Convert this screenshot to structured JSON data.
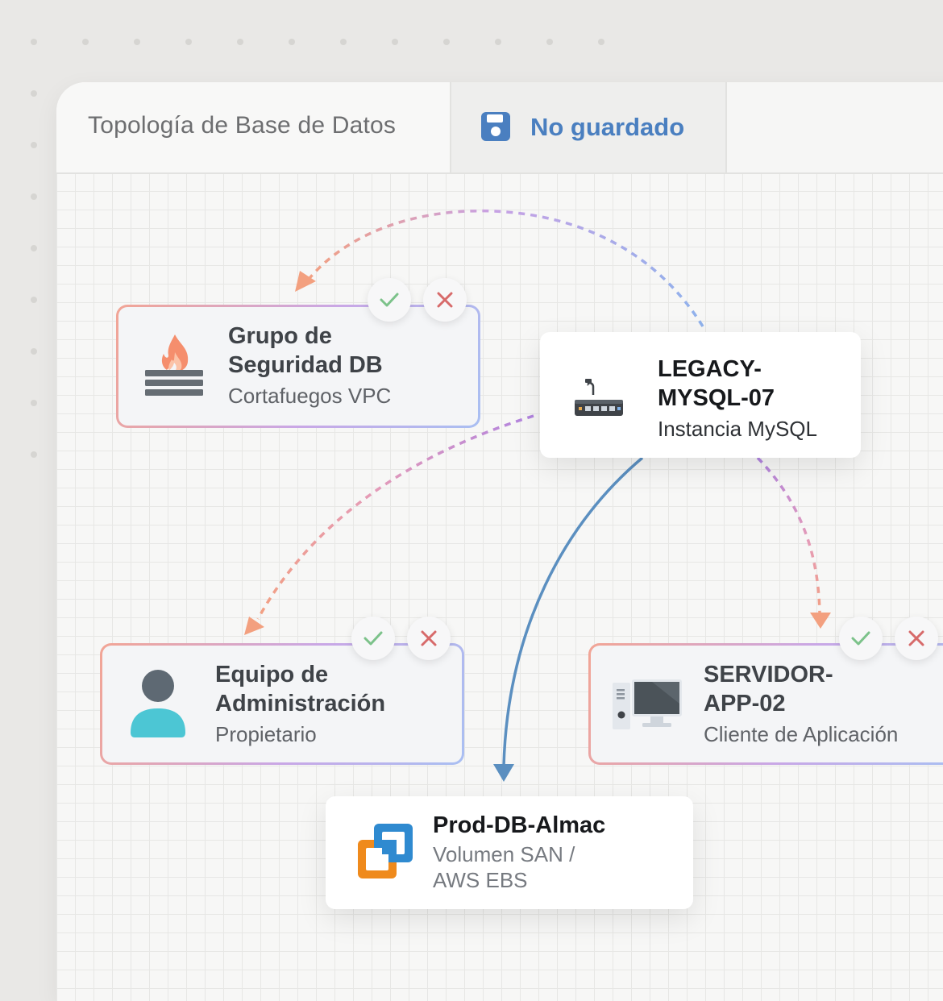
{
  "document": {
    "title": "Topología de Base de Datos",
    "save_status": "No guardado"
  },
  "colors": {
    "accent_blue": "#4a7fc0",
    "edge_salmon": "#f3a07f",
    "edge_purple": "#b184e0",
    "edge_blue": "#5b8fc0",
    "confirm_green": "#7cc28a",
    "reject_red": "#d76a6a"
  },
  "nodes": {
    "security_group": {
      "title": "Grupo de\nSeguridad DB",
      "subtitle": "Cortafuegos VPC",
      "icon": "firewall-icon"
    },
    "mysql_instance": {
      "title": "LEGACY-\nMYSQL-07",
      "subtitle": "Instancia MySQL",
      "icon": "router-icon"
    },
    "admin_team": {
      "title": "Equipo de\nAdministración",
      "subtitle": "Propietario",
      "icon": "user-icon"
    },
    "app_server": {
      "title": "SERVIDOR-\nAPP-02",
      "subtitle": "Cliente de Aplicación",
      "icon": "desktop-computer-icon"
    },
    "storage": {
      "title": "Prod-DB-Almac",
      "subtitle": "Volumen SAN /\nAWS EBS",
      "icon": "storage-volume-icon"
    }
  },
  "edges": [
    {
      "from": "mysql_instance",
      "to": "security_group",
      "style": "dashed",
      "gradient": [
        "#8fb2ec",
        "#c8a1e4",
        "#f3a07f"
      ]
    },
    {
      "from": "mysql_instance",
      "to": "admin_team",
      "style": "dashed",
      "gradient": [
        "#b184e0",
        "#e59bb7",
        "#f3a07f"
      ]
    },
    {
      "from": "mysql_instance",
      "to": "app_server",
      "style": "dashed",
      "gradient": [
        "#b184e0",
        "#e59bb7",
        "#f3a07f"
      ]
    },
    {
      "from": "mysql_instance",
      "to": "storage",
      "style": "solid",
      "gradient": [
        "#5b8fc0",
        "#5b8fc0"
      ]
    }
  ],
  "actions": {
    "confirm_icon": "check-icon",
    "reject_icon": "close-icon"
  }
}
